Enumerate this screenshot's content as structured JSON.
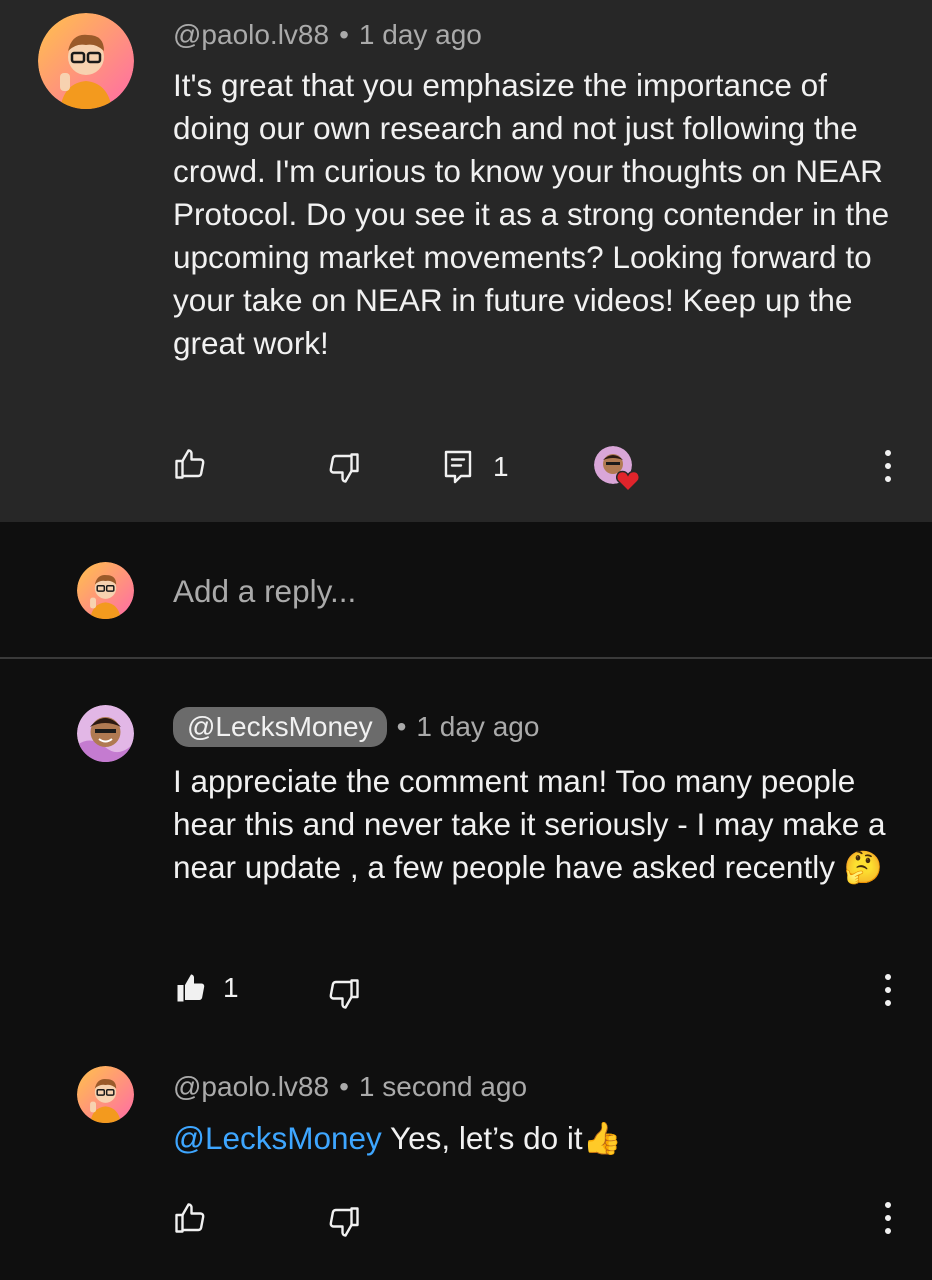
{
  "comment": {
    "author": "@paolo.lv88",
    "time": "1 day ago",
    "text": "It's great that you emphasize the importance of doing our own research and not just following the crowd. I'm curious to know your thoughts on NEAR Protocol. Do you see it as a strong contender in the upcoming market movements? Looking forward to your take on NEAR in future videos! Keep up the great work!",
    "reply_count": "1"
  },
  "reply_box": {
    "placeholder": "Add a reply..."
  },
  "replies": [
    {
      "author": "@LecksMoney",
      "time": "1 day ago",
      "text": "I appreciate the comment man! Too many people hear this and never take it seriously - I may make a near update , a few people have asked recently",
      "emoji": "🤔",
      "like_count": "1"
    },
    {
      "author": "@paolo.lv88",
      "time": "1 second ago",
      "mention": "@LecksMoney",
      "text": " Yes, let’s do it",
      "emoji": "👍"
    }
  ],
  "colors": {
    "comment_bg": "#272727",
    "page_bg": "#0f0f0f",
    "mention": "#3ea6ff",
    "creator_heart": "#e0242b"
  },
  "icons": [
    "like-icon",
    "dislike-icon",
    "reply-icon",
    "more-vert-icon",
    "creator-heart-icon"
  ]
}
